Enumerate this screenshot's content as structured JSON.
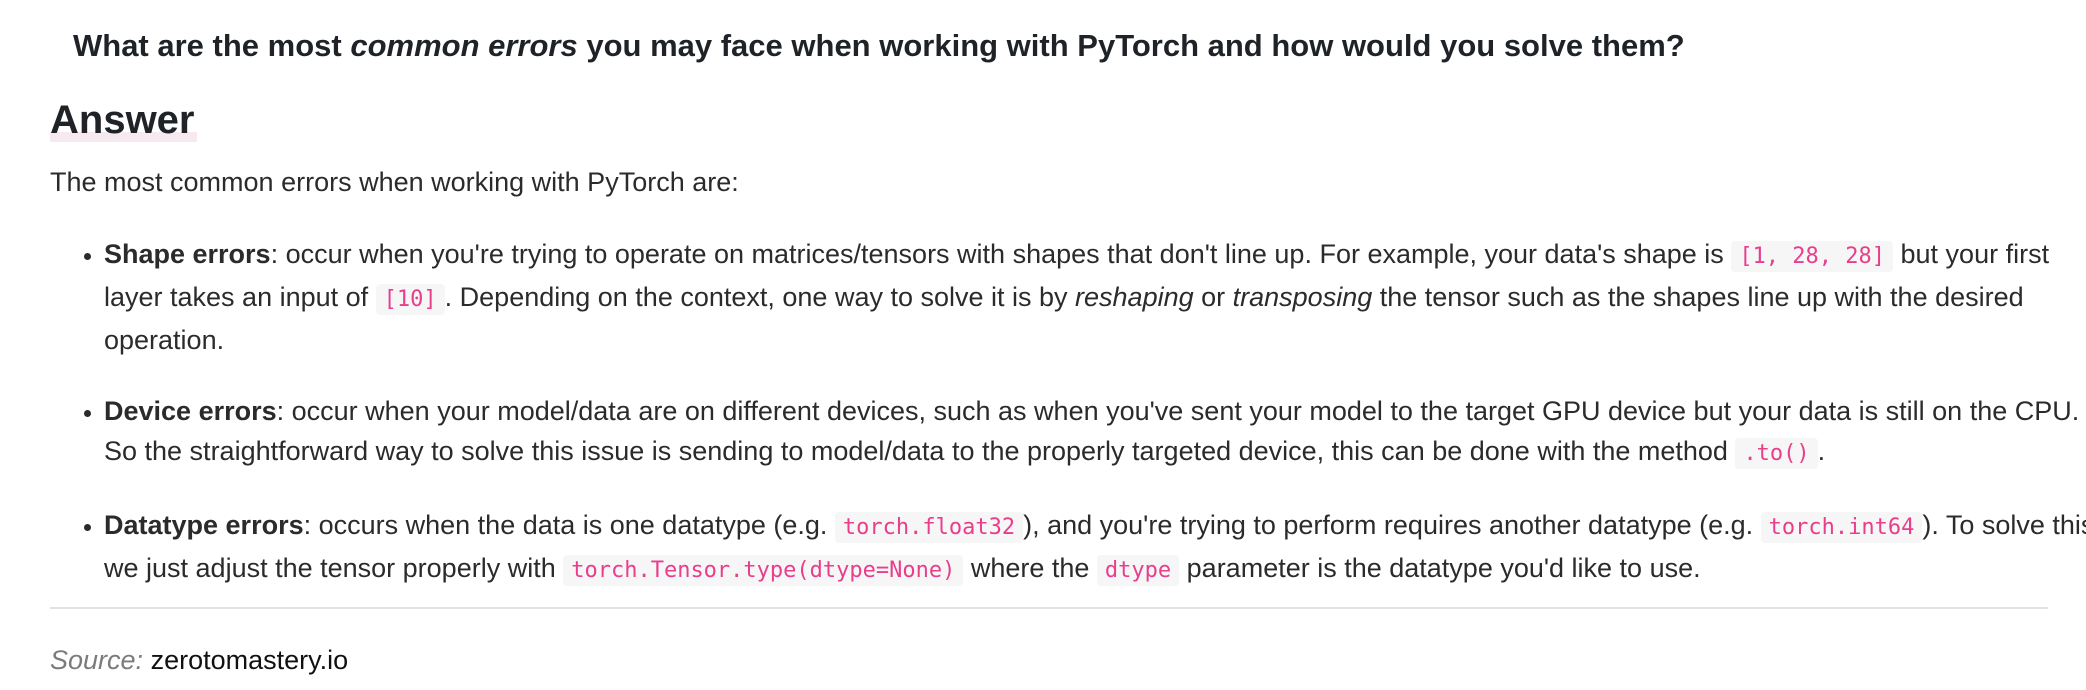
{
  "question": {
    "part1": "What are the most ",
    "emphasis": "common errors",
    "part2": " you may face when working with PyTorch and how would you solve them?"
  },
  "answer_heading": "Answer",
  "intro": "The most common errors when working with PyTorch are:",
  "errors": {
    "shape": {
      "title": "Shape errors",
      "t1": ": occur when you're trying to operate on matrices/tensors with shapes that don't line up. For example, your data's shape is ",
      "code1": "[1, 28, 28]",
      "t2": " but your first layer takes an input of ",
      "code2": "[10]",
      "t3": ". Depending on the context, one way to solve it is by ",
      "em1": "reshaping",
      "t4": " or ",
      "em2": "transposing",
      "t5": " the tensor such as the shapes line up with the desired operation."
    },
    "device": {
      "title": "Device errors",
      "t1": ": occur when your model/data are on different devices, such as when you've sent your model to the target GPU device but your data is still on the CPU. So the straightforward way to solve this issue is sending to model/data to the properly targeted device, this can be done with the method ",
      "code1": ".to()",
      "t2": "."
    },
    "datatype": {
      "title": "Datatype errors",
      "t1": ": occurs when the data is one datatype (e.g. ",
      "code1": "torch.float32",
      "t2": "), and you're trying to perform requires another datatype (e.g. ",
      "code2": "torch.int64",
      "t3": "). To solve this, we just adjust the tensor properly with ",
      "code3": "torch.Tensor.type(dtype=None)",
      "t4": " where the ",
      "code4": "dtype",
      "t5": " parameter is the datatype you'd like to use."
    }
  },
  "source": {
    "label": "Source:",
    "link": "zerotomastery.io"
  }
}
